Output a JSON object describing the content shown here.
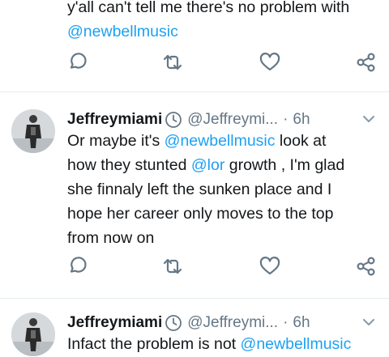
{
  "previous_tweet": {
    "text_lines": [
      "y'all can't tell me there's no problem with",
      "@newbellmusic"
    ]
  },
  "tweets": [
    {
      "display_name": "Jeffreymiami",
      "handle": "@Jeffreymi...",
      "separator": "·",
      "time": "6h",
      "lines": [
        [
          "Or maybe it's ",
          "@newbellmusic",
          " look at"
        ],
        [
          "how they stunted ",
          "@lor",
          " growth , I'm glad"
        ],
        [
          "she finnaly left the sunken place and I",
          "",
          ""
        ],
        [
          "hope her career only moves to the top",
          "",
          ""
        ],
        [
          "from now on",
          "",
          ""
        ]
      ]
    },
    {
      "display_name": "Jeffreymiami",
      "handle": "@Jeffreymi...",
      "separator": "·",
      "time": "6h",
      "lines": [
        [
          "Infact the problem is not ",
          "@newbellmusic",
          ""
        ]
      ]
    }
  ],
  "icons": {
    "reply": "reply-icon",
    "retweet": "retweet-icon",
    "like": "heart-icon",
    "share": "share-icon",
    "status": "clock-icon",
    "menu": "chevron-down-icon"
  },
  "colors": {
    "link": "#1da1f2",
    "secondary": "#657786",
    "divider": "#e6ecf0"
  }
}
